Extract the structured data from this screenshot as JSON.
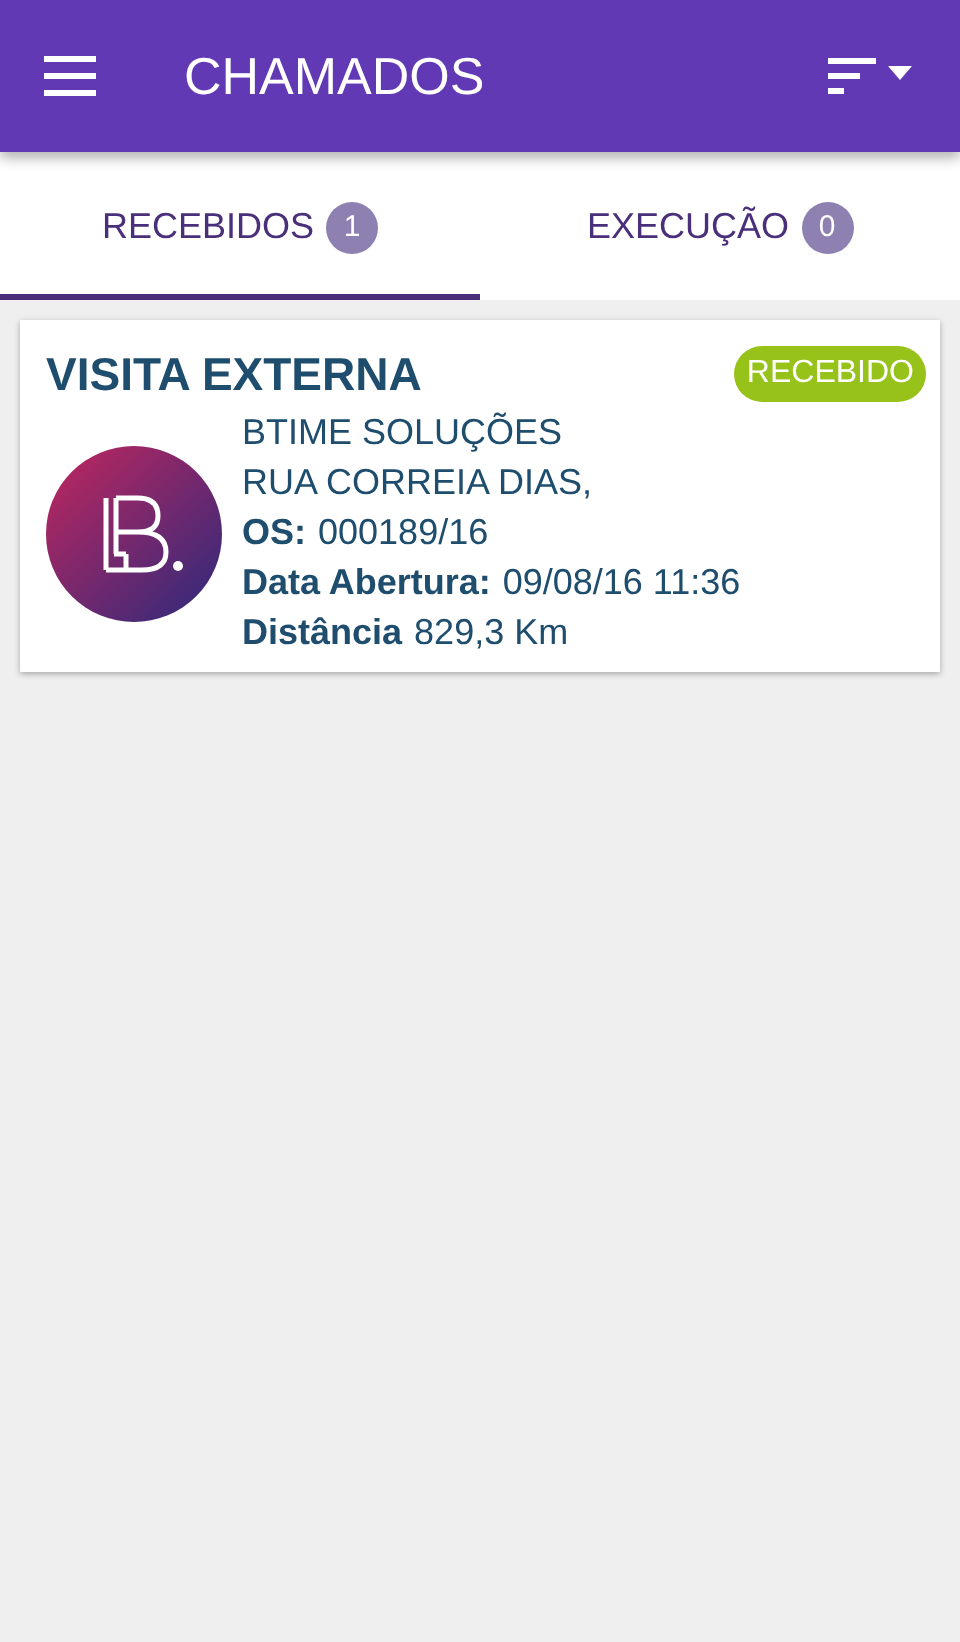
{
  "app_bar": {
    "title": "CHAMADOS"
  },
  "tabs": [
    {
      "label": "RECEBIDOS",
      "count": "1",
      "selected": true
    },
    {
      "label": "EXECUÇÃO",
      "count": "0",
      "selected": false
    }
  ],
  "cards": [
    {
      "title": "VISITA EXTERNA",
      "status": "RECEBIDO",
      "lines": [
        {
          "value": "BTIME SOLUÇÕES"
        },
        {
          "value": "RUA CORREIA DIAS,"
        },
        {
          "label": "OS:",
          "value": "000189/16"
        },
        {
          "label": "Data Abertura:",
          "value": "09/08/16 11:36"
        },
        {
          "label": "Distância",
          "value": "829,3 Km"
        }
      ]
    }
  ]
}
